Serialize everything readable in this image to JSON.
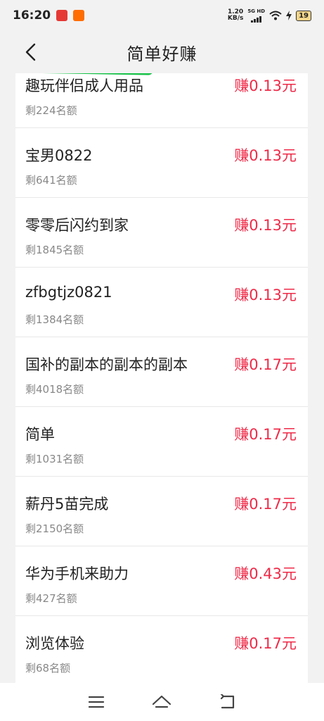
{
  "status_bar": {
    "time": "16:20",
    "speed_value": "1.20",
    "speed_unit": "KB/s",
    "network": "5G HD",
    "battery": "19"
  },
  "header": {
    "title": "简单好赚"
  },
  "tasks": [
    {
      "name": "趣玩伴侣成人用品",
      "quota": "剩224名额",
      "reward": "赚0.13元"
    },
    {
      "name": "宝男0822",
      "quota": "剩641名额",
      "reward": "赚0.13元"
    },
    {
      "name": "零零后闪约到家",
      "quota": "剩1845名额",
      "reward": "赚0.13元"
    },
    {
      "name": "zfbgtjz0821",
      "quota": "剩1384名额",
      "reward": "赚0.13元"
    },
    {
      "name": "国补的副本的副本的副本",
      "quota": "剩4018名额",
      "reward": "赚0.17元"
    },
    {
      "name": "简单",
      "quota": "剩1031名额",
      "reward": "赚0.17元"
    },
    {
      "name": "薪丹5苗完成",
      "quota": "剩2150名额",
      "reward": "赚0.17元"
    },
    {
      "name": "华为手机来助力",
      "quota": "剩427名额",
      "reward": "赚0.43元"
    },
    {
      "name": "浏览体验",
      "quota": "剩68名额",
      "reward": "赚0.17元"
    }
  ],
  "colors": {
    "reward": "#ef2a48",
    "background": "#f2f2f2"
  }
}
